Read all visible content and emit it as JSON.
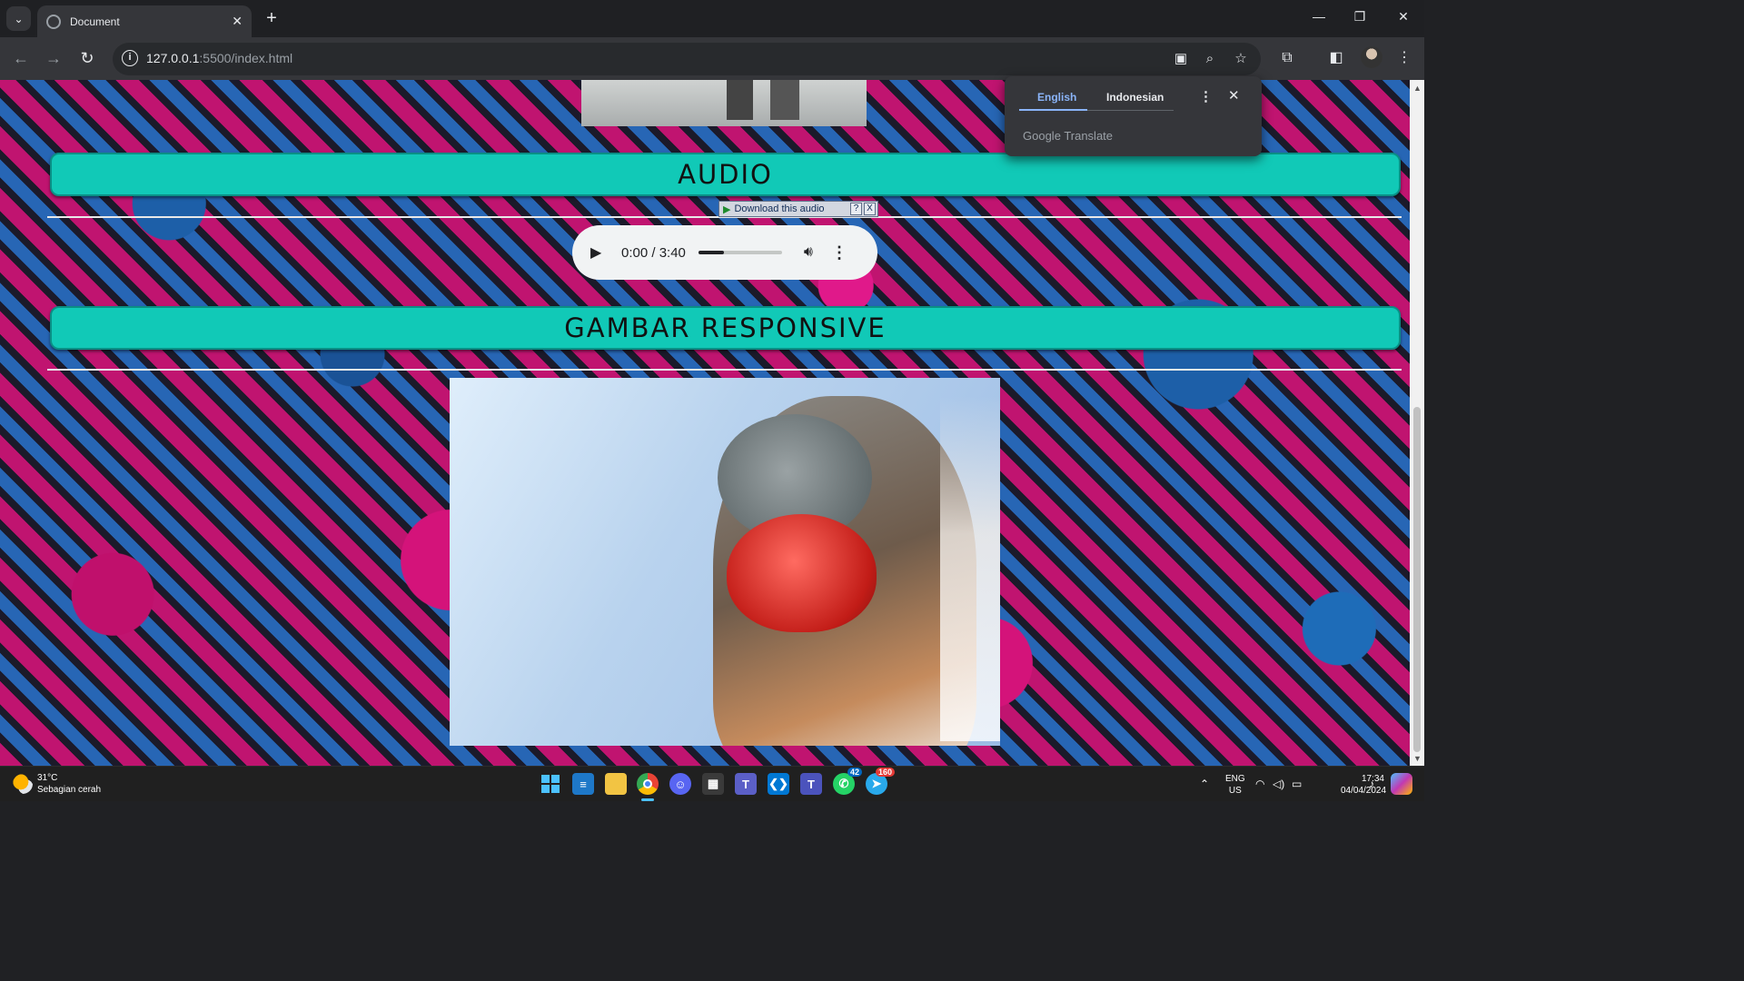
{
  "browser": {
    "tab_title": "Document",
    "url_host": "127.0.0.1",
    "url_path": ":5500/index.html",
    "new_tab_label": "+",
    "icons": [
      "chevron-down-icon",
      "globe-icon",
      "close-icon",
      "back-icon",
      "forward-icon",
      "reload-icon",
      "site-info-icon",
      "translate-icon",
      "zoom-icon",
      "star-icon",
      "extensions-icon",
      "side-panel-icon",
      "profile-icon",
      "more-icon"
    ]
  },
  "translate_popup": {
    "source_lang": "English",
    "target_lang": "Indonesian",
    "brand_google": "Google",
    "brand_translate": "Translate"
  },
  "page": {
    "audio_heading": "AUDIO",
    "image_heading": "GAMBAR RESPONSIVE",
    "download_label": "Download this audio",
    "download_help": "?",
    "download_close": "X",
    "audio_player": {
      "time": "0:00 / 3:40",
      "progress_fraction": 0.3
    },
    "colors": {
      "banner": "#11c9b7",
      "background_pink": "#d4137a",
      "background_blue": "#1d5fa8"
    }
  },
  "taskbar": {
    "weather_temp": "31°C",
    "weather_desc": "Sebagian cerah",
    "lang_primary": "ENG",
    "lang_region": "US",
    "time": "17:34",
    "date": "04/04/2024",
    "badges": {
      "whatsapp": "42",
      "telegram": "160"
    },
    "apps": [
      "windows-start-icon",
      "notepad-icon",
      "file-explorer-icon",
      "chrome-icon",
      "discord-icon",
      "store-icon",
      "teams-icon",
      "vscode-icon",
      "teams-classic-icon",
      "whatsapp-icon",
      "telegram-icon"
    ]
  }
}
